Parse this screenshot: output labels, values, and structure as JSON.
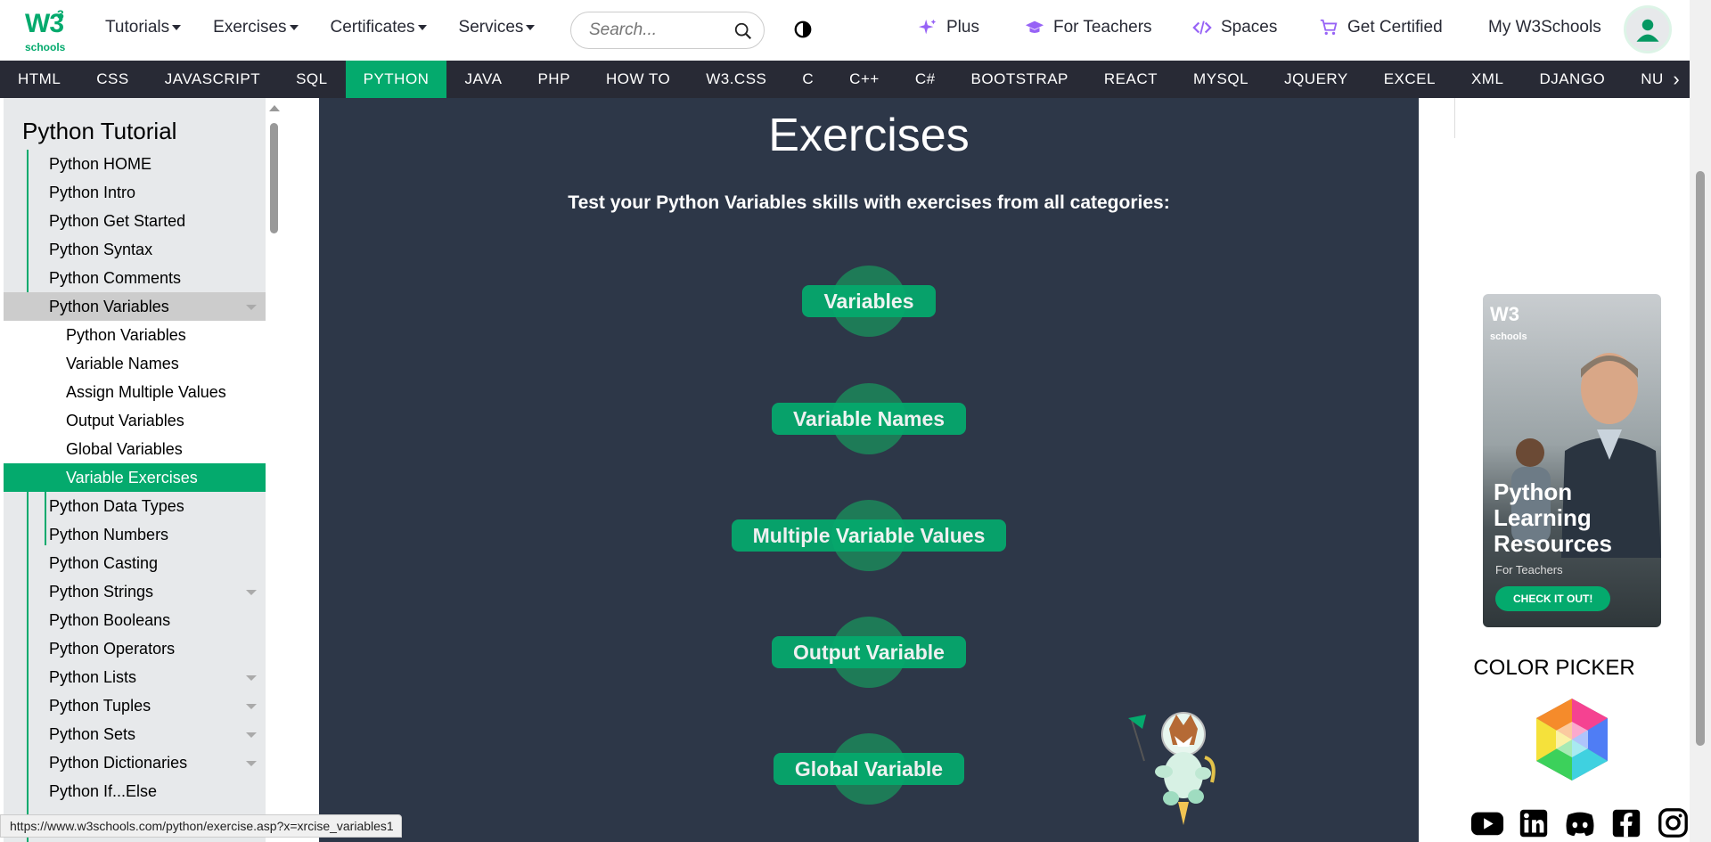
{
  "header": {
    "logo_text": "W3",
    "logo_sup": "3",
    "logo_sub": "schools",
    "nav": [
      "Tutorials",
      "Exercises",
      "Certificates",
      "Services"
    ],
    "search_placeholder": "Search...",
    "right_links": {
      "plus": "Plus",
      "teachers": "For Teachers",
      "spaces": "Spaces",
      "certified": "Get Certified",
      "my": "My W3Schools"
    }
  },
  "subjects": [
    "HTML",
    "CSS",
    "JAVASCRIPT",
    "SQL",
    "PYTHON",
    "JAVA",
    "PHP",
    "HOW TO",
    "W3.CSS",
    "C",
    "C++",
    "C#",
    "BOOTSTRAP",
    "REACT",
    "MYSQL",
    "JQUERY",
    "EXCEL",
    "XML",
    "DJANGO",
    "NUMPY"
  ],
  "active_subject": "PYTHON",
  "sidebar": {
    "title": "Python Tutorial",
    "items": [
      {
        "label": "Python HOME"
      },
      {
        "label": "Python Intro"
      },
      {
        "label": "Python Get Started"
      },
      {
        "label": "Python Syntax"
      },
      {
        "label": "Python Comments"
      },
      {
        "label": "Python Variables",
        "state": "open",
        "arrow": true
      },
      {
        "label": "Python Variables",
        "sub": true
      },
      {
        "label": "Variable Names",
        "sub": true
      },
      {
        "label": "Assign Multiple Values",
        "sub": true
      },
      {
        "label": "Output Variables",
        "sub": true
      },
      {
        "label": "Global Variables",
        "sub": true
      },
      {
        "label": "Variable Exercises",
        "sub": true,
        "state": "active"
      },
      {
        "label": "Python Data Types"
      },
      {
        "label": "Python Numbers"
      },
      {
        "label": "Python Casting"
      },
      {
        "label": "Python Strings",
        "arrow": true
      },
      {
        "label": "Python Booleans"
      },
      {
        "label": "Python Operators"
      },
      {
        "label": "Python Lists",
        "arrow": true
      },
      {
        "label": "Python Tuples",
        "arrow": true
      },
      {
        "label": "Python Sets",
        "arrow": true
      },
      {
        "label": "Python Dictionaries",
        "arrow": true
      },
      {
        "label": "Python If...Else"
      }
    ]
  },
  "main": {
    "title": "Exercises",
    "intro": "Test your Python Variables skills with exercises from all categories:",
    "categories": [
      "Variables",
      "Variable Names",
      "Multiple Variable Values",
      "Output Variable",
      "Global Variable"
    ]
  },
  "ad": {
    "logo": "W3",
    "sub": "schools",
    "title": "Python Learning Resources",
    "subtitle": "For Teachers",
    "button": "CHECK IT OUT!"
  },
  "color_picker": {
    "title": "COLOR PICKER"
  },
  "social_icons": [
    "youtube-icon",
    "linkedin-icon",
    "discord-icon",
    "facebook-icon",
    "instagram-icon"
  ],
  "status_url": "https://www.w3schools.com/python/exercise.asp?x=xrcise_variables1",
  "colors": {
    "accent": "#04AA6D",
    "dark": "#282A35",
    "main_bg": "#2D3748"
  }
}
